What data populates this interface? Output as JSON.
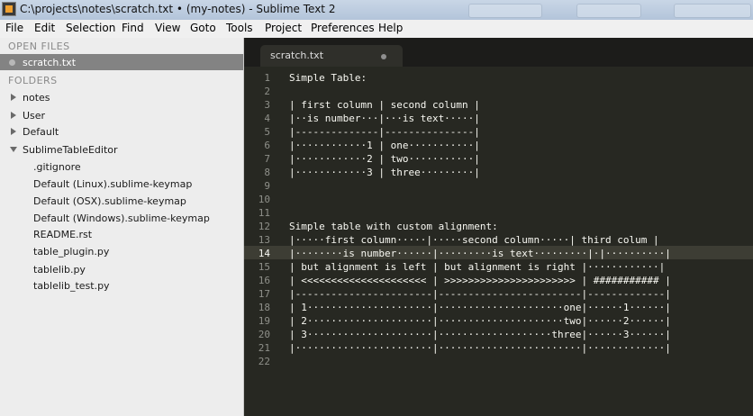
{
  "window": {
    "title": "C:\\projects\\notes\\scratch.txt • (my-notes) - Sublime Text 2"
  },
  "menu": [
    "File",
    "Edit",
    "Selection",
    "Find",
    "View",
    "Goto",
    "Tools",
    "Project",
    "Preferences",
    "Help"
  ],
  "sidebar": {
    "open_files_header": "OPEN FILES",
    "open_files": [
      "scratch.txt"
    ],
    "folders_header": "FOLDERS",
    "folders": [
      {
        "label": "notes",
        "expanded": false
      },
      {
        "label": "User",
        "expanded": false
      },
      {
        "label": "Default",
        "expanded": false
      },
      {
        "label": "SublimeTableEditor",
        "expanded": true
      }
    ],
    "files": [
      ".gitignore",
      "Default (Linux).sublime-keymap",
      "Default (OSX).sublime-keymap",
      "Default (Windows).sublime-keymap",
      "README.rst",
      "table_plugin.py",
      "tablelib.py",
      "tablelib_test.py"
    ]
  },
  "tab": {
    "label": "scratch.txt"
  },
  "editor": {
    "current_line": 14,
    "lines": [
      {
        "n": "1",
        "text": "Simple Table:"
      },
      {
        "n": "2",
        "text": ""
      },
      {
        "n": "3",
        "text": "| first column | second column |"
      },
      {
        "n": "4",
        "text": "|··is number···|···is text·····|"
      },
      {
        "n": "5",
        "text": "|--------------|---------------|"
      },
      {
        "n": "6",
        "text": "|············1 | one···········|"
      },
      {
        "n": "7",
        "text": "|············2 | two···········|"
      },
      {
        "n": "8",
        "text": "|············3 | three·········|"
      },
      {
        "n": "9",
        "text": ""
      },
      {
        "n": "10",
        "text": ""
      },
      {
        "n": "11",
        "text": ""
      },
      {
        "n": "12",
        "text": "Simple table with custom alignment:"
      },
      {
        "n": "13",
        "text": "|·····first column·····|·····second column·····| third colum |"
      },
      {
        "n": "14",
        "text": "|········is number······|·········is text·········|·|··········|"
      },
      {
        "n": "15",
        "text": "| but alignment is left | but alignment is right |············|"
      },
      {
        "n": "16",
        "text": "| <<<<<<<<<<<<<<<<<<<<< | >>>>>>>>>>>>>>>>>>>>>> | ########### |"
      },
      {
        "n": "17",
        "text": "|-----------------------|------------------------|-------------|"
      },
      {
        "n": "18",
        "text": "| 1·····················|·····················one|······1······|"
      },
      {
        "n": "19",
        "text": "| 2·····················|·····················two|······2······|"
      },
      {
        "n": "20",
        "text": "| 3·····················|···················three|······3······|"
      },
      {
        "n": "21",
        "text": "|·······················|························|·············|"
      },
      {
        "n": "22",
        "text": ""
      }
    ]
  }
}
